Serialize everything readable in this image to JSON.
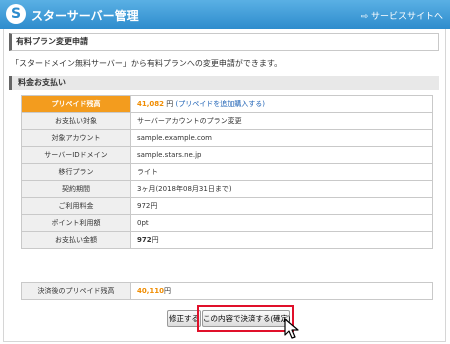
{
  "header": {
    "brand": "スターサーバー管理",
    "site_link": "⇨ サービスサイトへ"
  },
  "page": {
    "title": "有料プラン変更申請",
    "intro": "「スタードメイン無料サーバー」から有料プランへの変更申請ができます。",
    "section_title": "料金お支払い"
  },
  "prepaid": {
    "label": "プリペイド残高",
    "amount": "41,082",
    "unit": "円",
    "link": "(プリペイドを追加購入する)"
  },
  "details": [
    {
      "label": "お支払い対象",
      "value": "サーバーアカウントのプラン変更"
    },
    {
      "label": "対象アカウント",
      "value": "sample.example.com"
    },
    {
      "label": "サーバーIDドメイン",
      "value": "sample.stars.ne.jp"
    },
    {
      "label": "移行プラン",
      "value": "ライト"
    },
    {
      "label": "契約期間",
      "value": "3ヶ月(2018年08月31日まで)"
    },
    {
      "label": "ご利用料金",
      "value": "972円"
    },
    {
      "label": "ポイント利用額",
      "value": "0pt"
    }
  ],
  "total": {
    "label": "お支払い金額",
    "amount": "972",
    "unit": "円"
  },
  "after": {
    "label": "決済後のプリペイド残高",
    "amount": "40,110",
    "unit": "円"
  },
  "buttons": {
    "back": "修正する",
    "confirm": "この内容で決済する(確定)"
  },
  "colors": {
    "header": "#2e8ccd",
    "accent": "#f39c1e",
    "highlight": "#e0102a"
  }
}
